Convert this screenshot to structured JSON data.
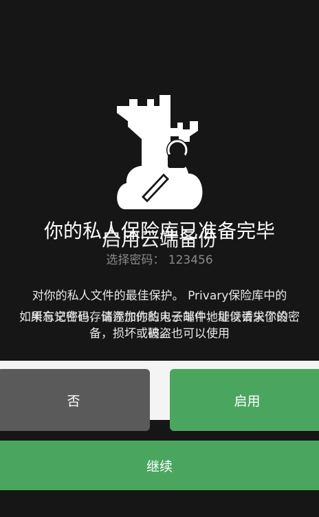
{
  "title_primary": "你的私人保险库已准备完毕",
  "title_overlay": "启用云端备份",
  "password": {
    "label": "选择密码：",
    "value": "123456"
  },
  "description": {
    "line1": "对你的私人文件的最佳保护。 Privary保险库中的",
    "line2": "如果忘记密码，请添加你的电子邮件地址以请求你的密",
    "line2_overlay": "所有文件也存储在你的私人云端中，即使丢失了设",
    "line3": "备，损坏或被盗也可以使用",
    "line3_overlay": "码。"
  },
  "buttons": {
    "no": "否",
    "enable": "启用",
    "continue": "继续"
  },
  "colors": {
    "background": "#161616",
    "accent_green": "#4aa65e",
    "secondary_gray": "#5a5a5a"
  }
}
